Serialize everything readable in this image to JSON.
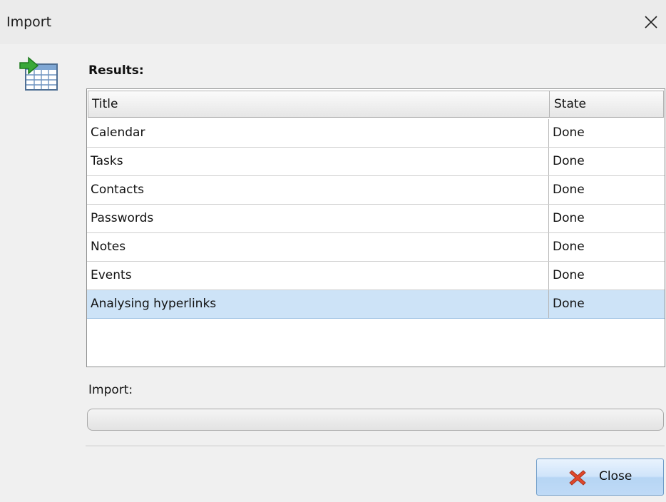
{
  "window": {
    "title": "Import",
    "close_icon": "close-icon"
  },
  "results": {
    "label": "Results:",
    "columns": [
      "Title",
      "State"
    ],
    "rows": [
      {
        "title": "Calendar",
        "state": "Done",
        "selected": false
      },
      {
        "title": "Tasks",
        "state": "Done",
        "selected": false
      },
      {
        "title": "Contacts",
        "state": "Done",
        "selected": false
      },
      {
        "title": "Passwords",
        "state": "Done",
        "selected": false
      },
      {
        "title": "Notes",
        "state": "Done",
        "selected": false
      },
      {
        "title": "Events",
        "state": "Done",
        "selected": false
      },
      {
        "title": "Analysing hyperlinks",
        "state": "Done",
        "selected": true
      }
    ]
  },
  "import_progress": {
    "label": "Import:",
    "value": 0
  },
  "footer": {
    "close_label": "Close",
    "close_icon": "red-x-icon"
  },
  "icons": {
    "app": "import-table-icon"
  },
  "colors": {
    "selection": "#cde3f7",
    "button_accent": "#b6d5f4",
    "close_icon_red": "#e0472b",
    "arrow_green": "#3aa83a"
  }
}
